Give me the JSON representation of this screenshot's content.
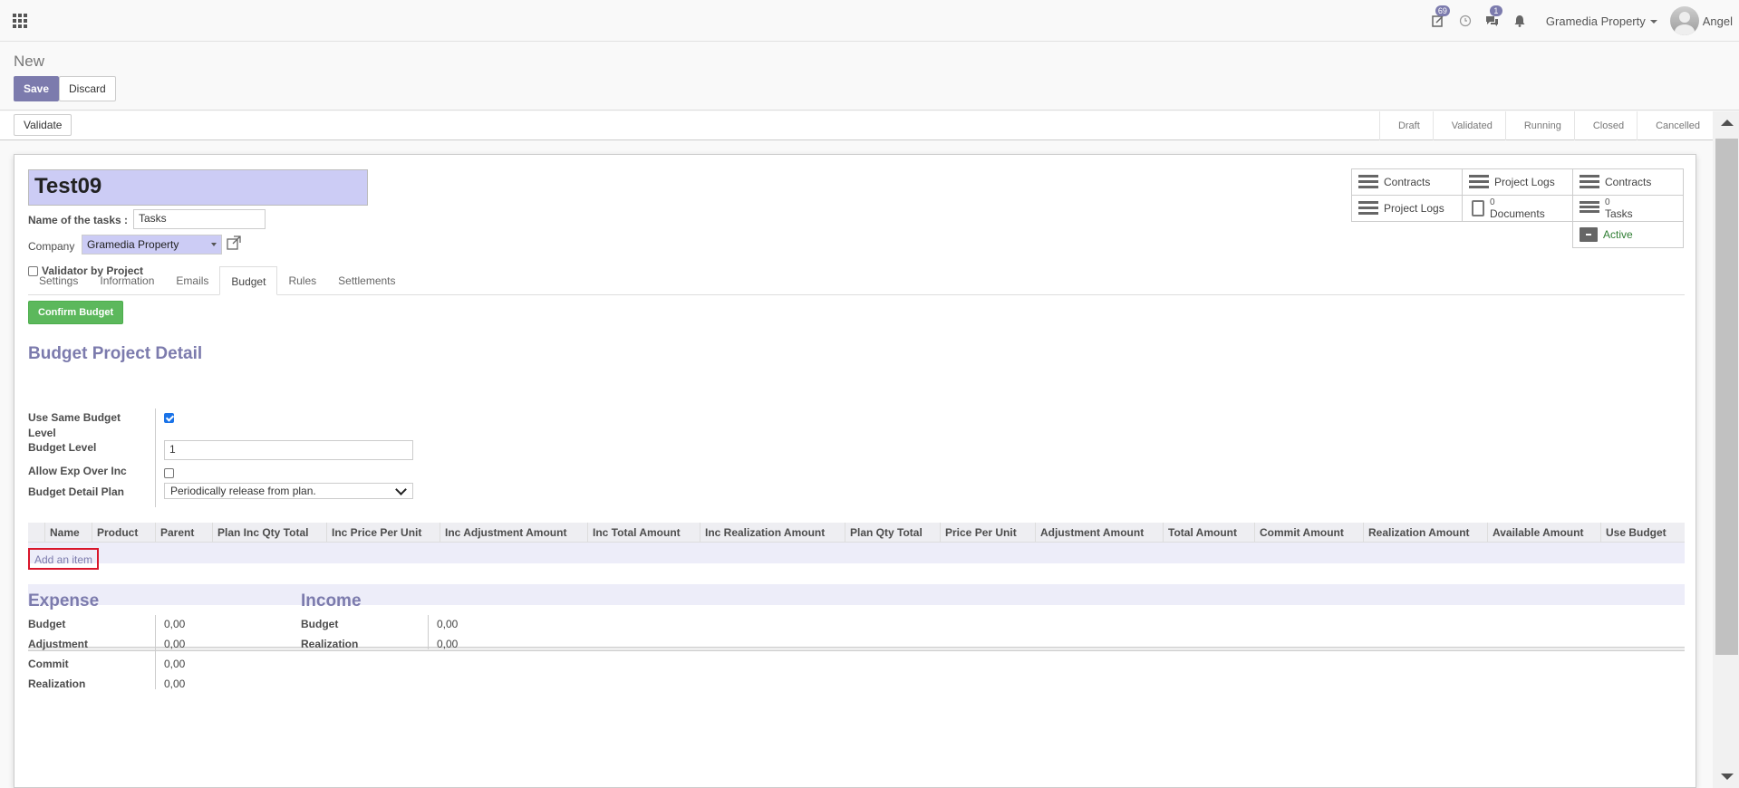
{
  "navbar": {
    "badges": {
      "activity": "69",
      "messages": "1"
    },
    "company": "Gramedia Property",
    "user": "Angel"
  },
  "control_panel": {
    "breadcrumb": "New",
    "save_label": "Save",
    "discard_label": "Discard"
  },
  "statusbar": {
    "validate_label": "Validate",
    "stages": [
      "Draft",
      "Validated",
      "Running",
      "Closed",
      "Cancelled"
    ]
  },
  "form": {
    "title": "Test09",
    "tasks_label": "Name of the tasks :",
    "tasks_value": "Tasks",
    "company_label": "Company",
    "company_value": "Gramedia Property",
    "validator_label": "Validator by Project"
  },
  "smart_buttons": {
    "contracts1": "Contracts",
    "project_logs1": "Project Logs",
    "contracts2": "Contracts",
    "project_logs2": "Project Logs",
    "documents_count": "0",
    "documents_label": "Documents",
    "tasks_count": "0",
    "tasks_label": "Tasks",
    "active_label": "Active"
  },
  "tabs": [
    "Settings",
    "Information",
    "Emails",
    "Budget",
    "Rules",
    "Settlements"
  ],
  "budget": {
    "confirm_label": "Confirm Budget",
    "section_title": "Budget Project Detail",
    "use_same_label_1": "Use Same Budget",
    "use_same_label_2": "Level",
    "budget_level_label": "Budget Level",
    "budget_level_value": "1",
    "allow_exp_label": "Allow Exp Over Inc",
    "detail_plan_label": "Budget Detail Plan",
    "detail_plan_value": "Periodically release from plan."
  },
  "table": {
    "columns": [
      "Name",
      "Product",
      "Parent",
      "Plan Inc Qty Total",
      "Inc Price Per Unit",
      "Inc Adjustment Amount",
      "Inc Total Amount",
      "Inc Realization Amount",
      "Plan Qty Total",
      "Price Per Unit",
      "Adjustment Amount",
      "Total Amount",
      "Commit Amount",
      "Realization Amount",
      "Available Amount",
      "Use Budget"
    ],
    "add_item": "Add an item"
  },
  "expense": {
    "title": "Expense",
    "budget_label": "Budget",
    "budget": "0,00",
    "adjustment_label": "Adjustment",
    "adjustment": "0,00",
    "commit_label": "Commit",
    "commit": "0,00",
    "realization_label": "Realization",
    "realization": "0,00"
  },
  "income": {
    "title": "Income",
    "budget_label": "Budget",
    "budget": "0,00",
    "realization_label": "Realization",
    "realization": "0,00"
  },
  "colors": {
    "accent": "#7c7bad",
    "success": "#5cb85c",
    "highlight": "#d9162b"
  }
}
